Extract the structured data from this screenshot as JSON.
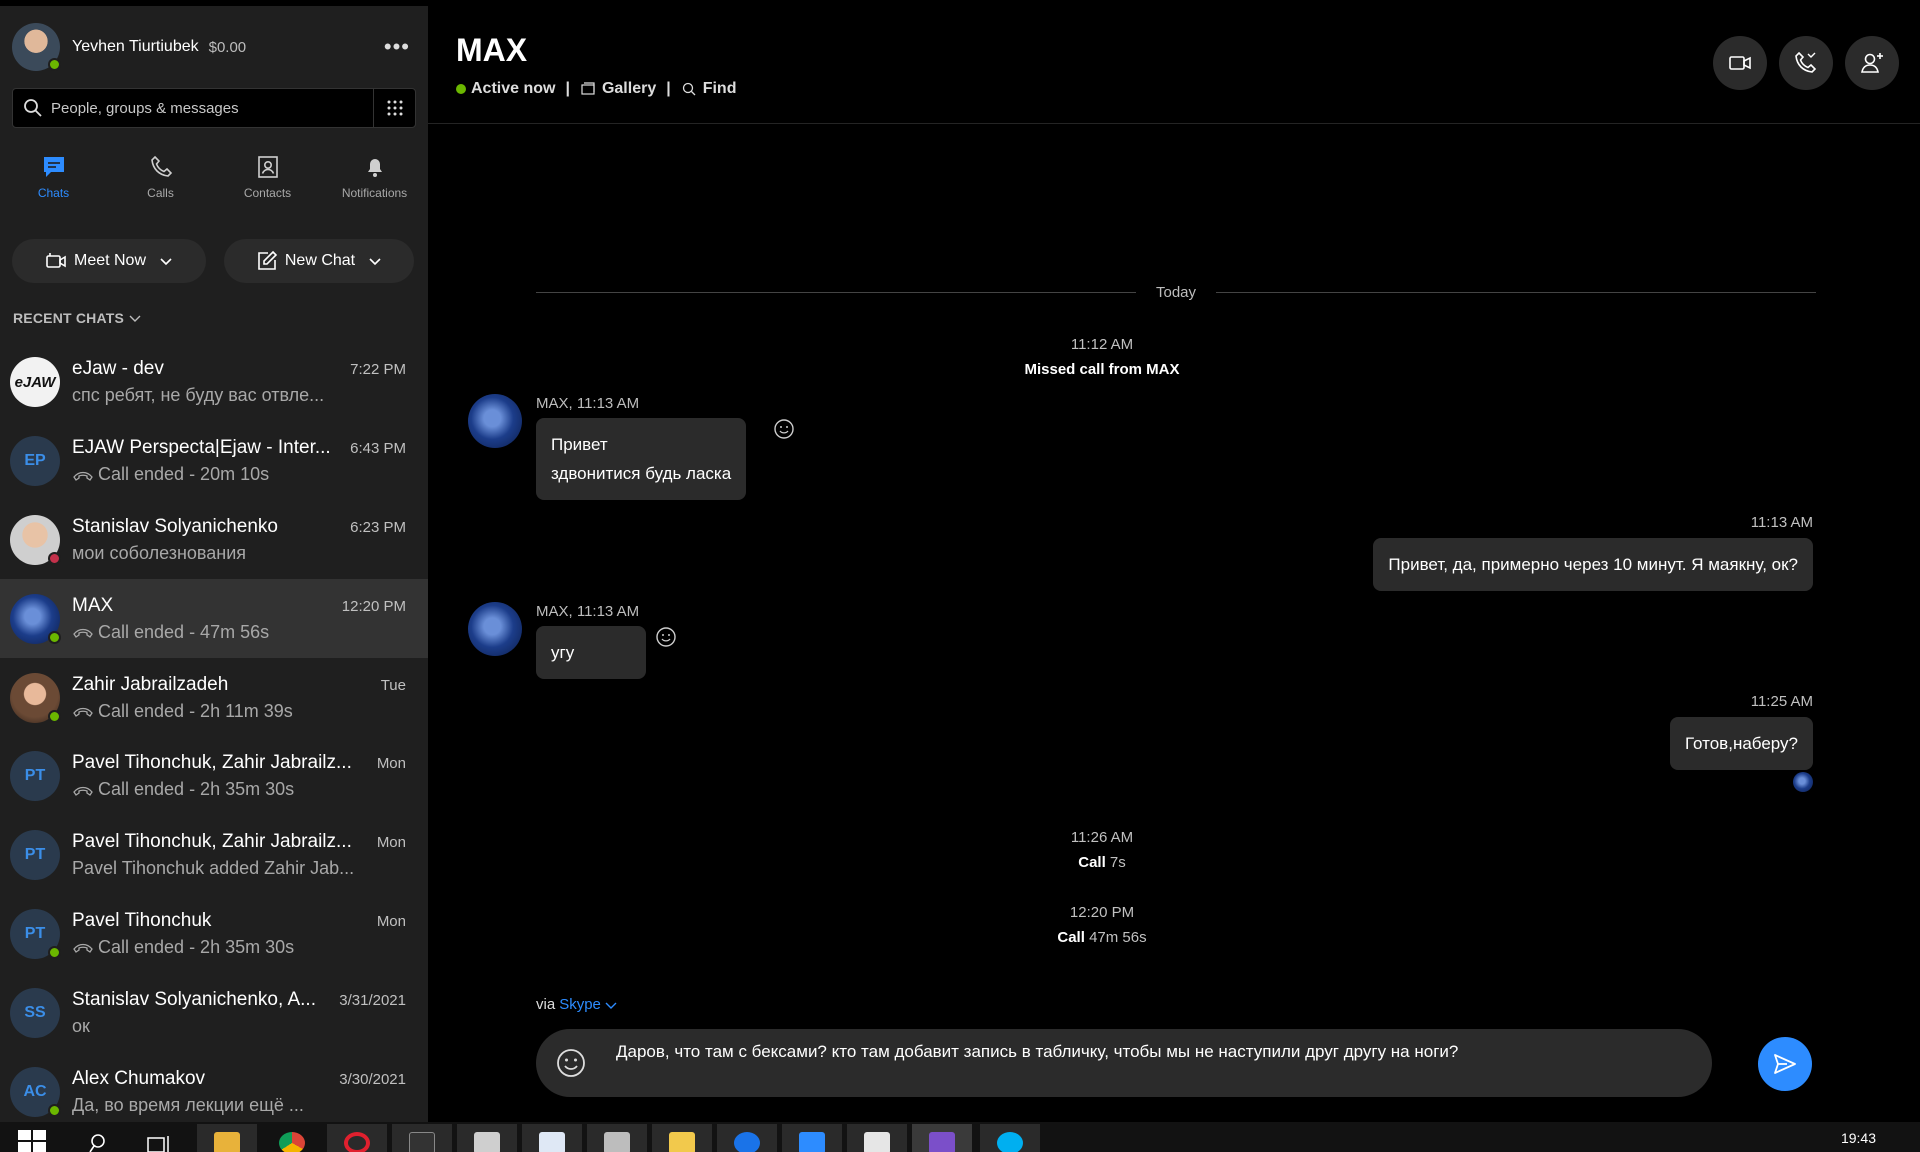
{
  "profile": {
    "name": "Yevhen Tiurtiubek",
    "credit": "$0.00",
    "more": "•••"
  },
  "search": {
    "placeholder": "People, groups & messages"
  },
  "nav": [
    {
      "label": "Chats",
      "icon": "chat-icon",
      "active": true
    },
    {
      "label": "Calls",
      "icon": "phone-icon",
      "active": false
    },
    {
      "label": "Contacts",
      "icon": "contacts-icon",
      "active": false
    },
    {
      "label": "Notifications",
      "icon": "bell-icon",
      "active": false
    }
  ],
  "actions": {
    "meet_now": "Meet Now",
    "new_chat": "New Chat"
  },
  "recent_header": "RECENT CHATS",
  "chats": [
    {
      "title": "eJaw - dev",
      "time": "7:22 PM",
      "preview": "спс ребят, не буду вас отвле...",
      "call": false,
      "avatar_text": "eJAW",
      "presence": ""
    },
    {
      "title": "EJAW Perspecta|Ejaw - Inter...",
      "time": "6:43 PM",
      "preview": "Call ended - 20m 10s",
      "call": true,
      "avatar_text": "EP",
      "presence": ""
    },
    {
      "title": "Stanislav Solyanichenko",
      "time": "6:23 PM",
      "preview": "мои соболезнования",
      "call": false,
      "avatar_text": "",
      "presence": "busy"
    },
    {
      "title": "MAX",
      "time": "12:20 PM",
      "preview": "Call ended - 47m 56s",
      "call": true,
      "avatar_text": "",
      "presence": "online"
    },
    {
      "title": "Zahir Jabrailzadeh",
      "time": "Tue",
      "preview": "Call ended - 2h 11m 39s",
      "call": true,
      "avatar_text": "",
      "presence": "online"
    },
    {
      "title": "Pavel Tihonchuk, Zahir Jabrailz...",
      "time": "Mon",
      "preview": "Call ended - 2h 35m 30s",
      "call": true,
      "avatar_text": "PT",
      "presence": ""
    },
    {
      "title": "Pavel Tihonchuk, Zahir Jabrailz...",
      "time": "Mon",
      "preview": "Pavel Tihonchuk added Zahir Jab...",
      "call": false,
      "avatar_text": "PT",
      "presence": ""
    },
    {
      "title": "Pavel Tihonchuk",
      "time": "Mon",
      "preview": "Call ended - 2h 35m 30s",
      "call": true,
      "avatar_text": "PT",
      "presence": "online"
    },
    {
      "title": "Stanislav Solyanichenko, A...",
      "time": "3/31/2021",
      "preview": "ок",
      "call": false,
      "avatar_text": "SS",
      "presence": ""
    },
    {
      "title": "Alex Chumakov",
      "time": "3/30/2021",
      "preview": "Да, во время лекции ещё ...",
      "call": false,
      "avatar_text": "AC",
      "presence": "online"
    }
  ],
  "header": {
    "title": "MAX",
    "status": "Active now",
    "gallery": "Gallery",
    "find": "Find",
    "sep": "|"
  },
  "conversation": {
    "today": "Today",
    "missed_time": "11:12 AM",
    "missed_text": "Missed call from MAX",
    "msg1_meta": "MAX, 11:13 AM",
    "msg1_line1": "Привет",
    "msg1_line2": "здвонитися будь ласка",
    "out1_time": "11:13 AM",
    "out1_text": "Привет, да, примерно через 10 минут. Я маякну, ок?",
    "msg2_meta": "MAX, 11:13 AM",
    "msg2_text": "угу",
    "out2_time": "11:25 AM",
    "out2_text": "Готов,наберу?",
    "call1_time": "11:26 AM",
    "call1_label": "Call",
    "call1_duration": "7s",
    "call2_time": "12:20 PM",
    "call2_label": "Call",
    "call2_duration": "47m 56s"
  },
  "composer": {
    "via": "via",
    "via_link": "Skype",
    "draft": "Даров, что там с бексами? кто там добавит запись в табличку, чтобы мы не наступили друг другу на ноги?"
  },
  "taskbar": {
    "clock": "19:43"
  },
  "colors": {
    "accent": "#2d8cff",
    "online": "#6bb700",
    "busy": "#c4314b",
    "sidebar_bg": "#1f1f1f",
    "bubble_bg": "#2b2b2b"
  }
}
